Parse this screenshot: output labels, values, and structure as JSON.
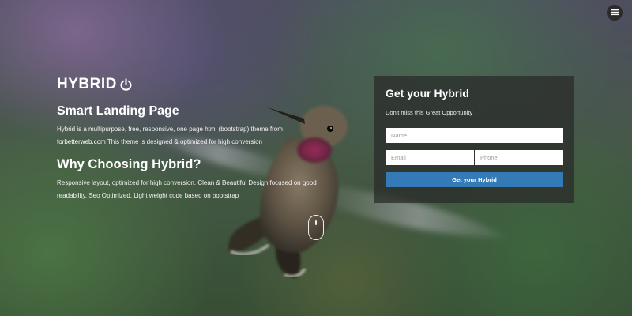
{
  "nav": {
    "menu_icon": "hamburger-menu-icon"
  },
  "hero": {
    "logo_text": "HYBRID",
    "logo_icon": "power-icon",
    "heading_1": "Smart Landing Page",
    "para_1_before": "Hybrid is a multipurpose, free, responsive, one page html (bootstrap) theme from ",
    "para_1_link": "forbetterweb.com",
    "para_1_after": " This theme is designed & optimized for high conversion",
    "heading_2": "Why Choosing Hybrid?",
    "para_2": "Responsive layout, optimized for high conversion. Clean & Beautiful Design focused on good readability. Seo Optimized, Light weight code based on bootstrap"
  },
  "scroll_indicator": {
    "icon": "mouse-scroll-icon"
  },
  "form": {
    "title": "Get your Hybrid",
    "subtitle": "Don't miss this Great Opportunity",
    "name_placeholder": "Name",
    "email_placeholder": "Email",
    "phone_placeholder": "Phone",
    "submit_label": "Get your Hybrid"
  },
  "colors": {
    "panel_bg": "#282828",
    "button_blue": "#337ab7",
    "menu_button": "#2b2b2b",
    "text": "#ffffff"
  }
}
